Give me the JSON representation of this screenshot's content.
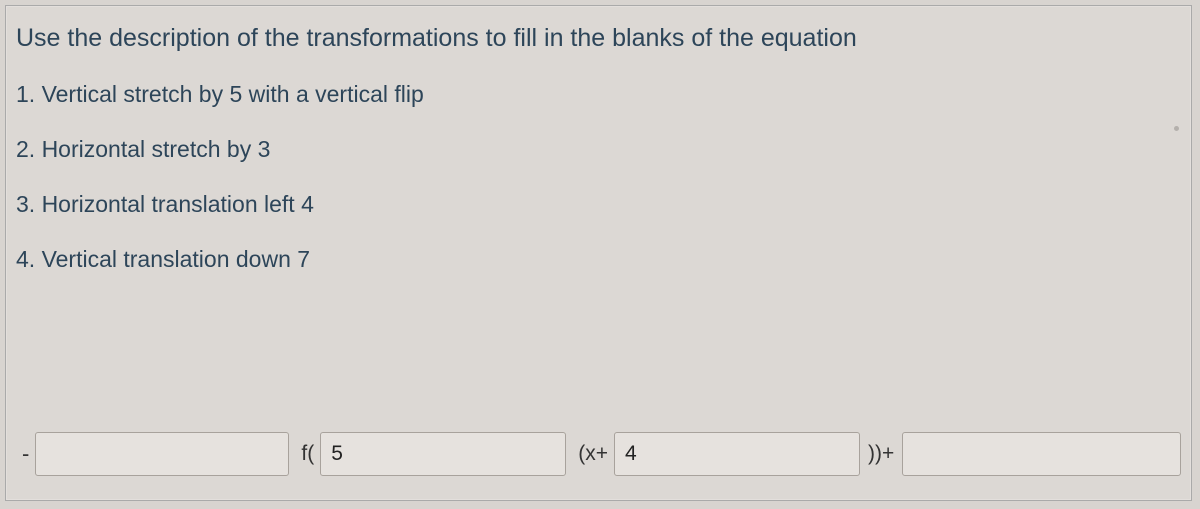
{
  "instruction": "Use the description of the transformations to fill in the blanks of the equation",
  "items": [
    "1. Vertical stretch by 5 with a vertical flip",
    "2. Horizontal stretch by 3",
    "3. Horizontal translation left 4",
    "4. Vertical translation down 7"
  ],
  "equation": {
    "leading_sign": "-",
    "f_open": "f(",
    "blank_a_value": "",
    "blank_b_value": "5",
    "x_plus": "(x+",
    "blank_c_value": "4",
    "close_plus": "))+",
    "blank_d_value": ""
  }
}
